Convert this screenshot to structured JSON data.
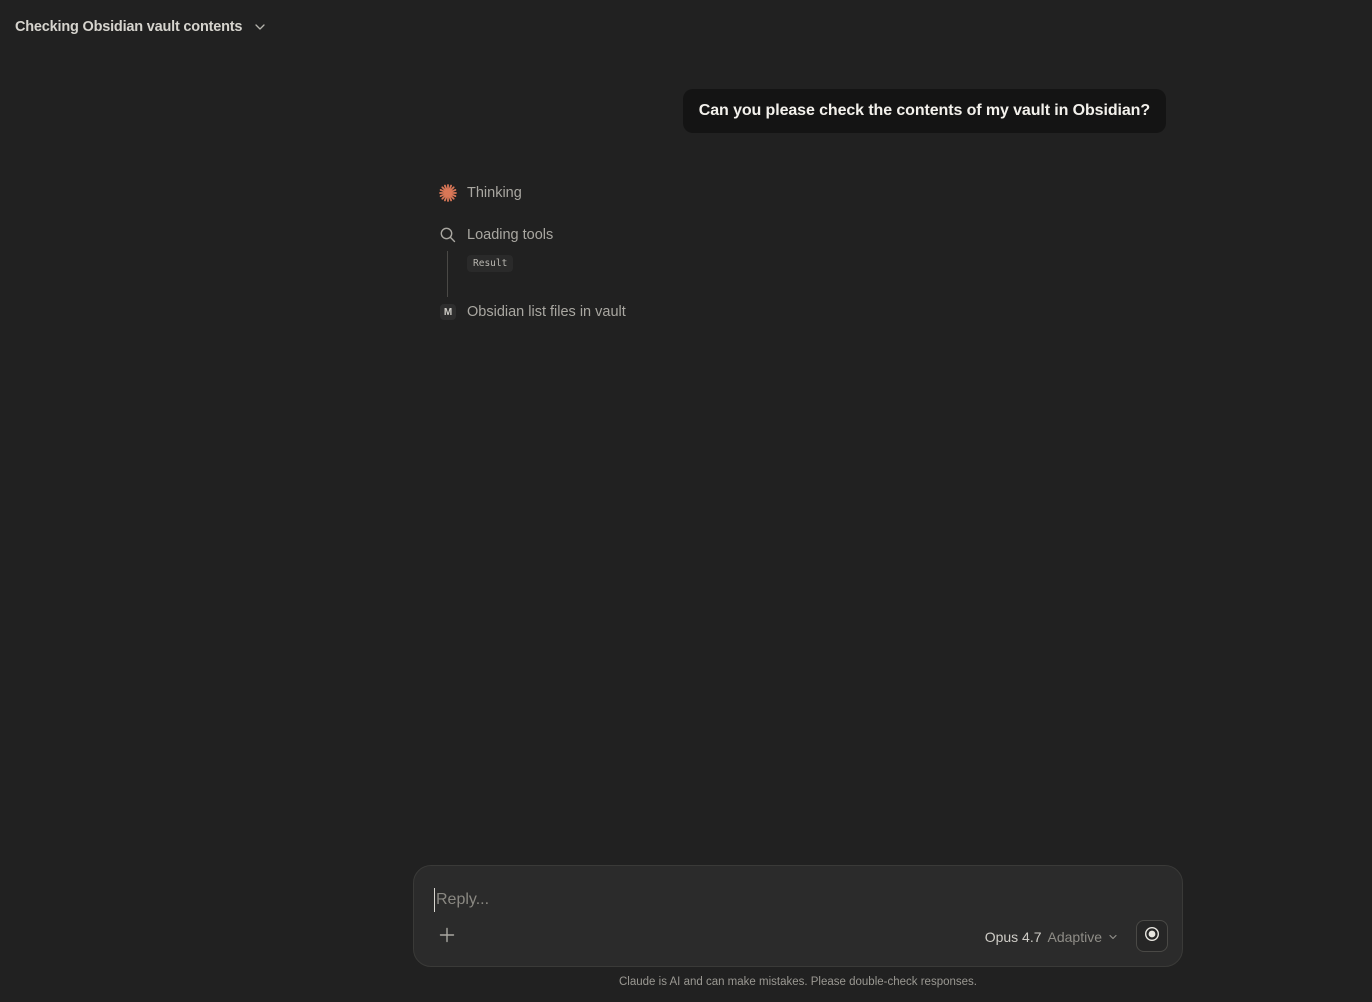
{
  "header": {
    "title": "Checking Obsidian vault contents",
    "chevron_icon": "chevron-down-icon"
  },
  "conversation": {
    "user_message": "Can you please check the contents of my vault in Obsidian?",
    "steps": {
      "thinking": {
        "label": "Thinking",
        "icon": "claude-spark-icon",
        "icon_color": "#d97757"
      },
      "loading": {
        "label": "Loading tools",
        "icon": "search-icon",
        "result_label": "Result"
      },
      "obsidian": {
        "label": "Obsidian list files in vault",
        "badge": "M"
      }
    }
  },
  "composer": {
    "placeholder": "Reply...",
    "model_name": "Opus 4.7",
    "model_mode": "Adaptive",
    "plus_icon": "plus-icon",
    "voice_icon": "voice-mode-icon"
  },
  "footer": {
    "disclaimer": "Claude is AI and can make mistakes. Please double-check responses."
  },
  "colors": {
    "background": "#212121",
    "user_bubble": "#141414",
    "accent": "#d97757"
  }
}
